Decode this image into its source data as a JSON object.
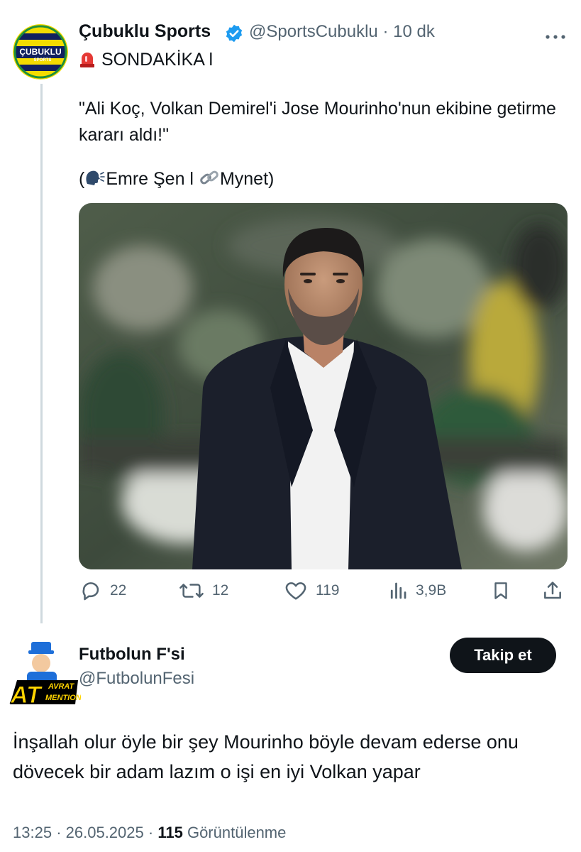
{
  "tweet": {
    "author_name": "Çubuklu Sports",
    "author_handle": "@SportsCubuklu",
    "time": "10 dk",
    "separator": "·",
    "alarm_line": "SONDAKİKA l",
    "quote": "\"Ali Koç, Volkan Demirel'i Jose Mourinho'nun ekibine getirme kararı aldı!\"",
    "source_prefix": "(",
    "source_person": "Emre Şen l",
    "source_outlet": "Mynet)",
    "avatar_logo_text": "ÇUBUKLU",
    "avatar_logo_sub": "SPORTS",
    "icons": [
      "verified-badge-icon",
      "more-icon",
      "alarm-light-icon",
      "speaking-head-icon",
      "link-icon",
      "reply-icon",
      "retweet-icon",
      "like-icon",
      "views-icon",
      "bookmark-icon",
      "share-icon"
    ],
    "stats": {
      "replies": "22",
      "retweets": "12",
      "likes": "119",
      "views": "3,9B"
    }
  },
  "reply": {
    "author_name": "Futbolun F'si",
    "author_handle": "@FutbolunFesi",
    "follow_label": "Takip et",
    "text": "İnşallah olur öyle bir şey Mourinho böyle devam ederse onu dövecek bir adam lazım o işi en iyi Volkan yapar",
    "avatar_text_top": "AVRAT",
    "avatar_text_big": "AT",
    "avatar_text_bottom": "MENTION",
    "time": "13:25",
    "date": "26.05.2025",
    "views_count": "115",
    "views_label": "Görüntülenme"
  },
  "colors": {
    "text": "#0f1419",
    "secondary": "#536471",
    "verified": "#1d9bf0",
    "thread_line": "#cfd9de"
  }
}
